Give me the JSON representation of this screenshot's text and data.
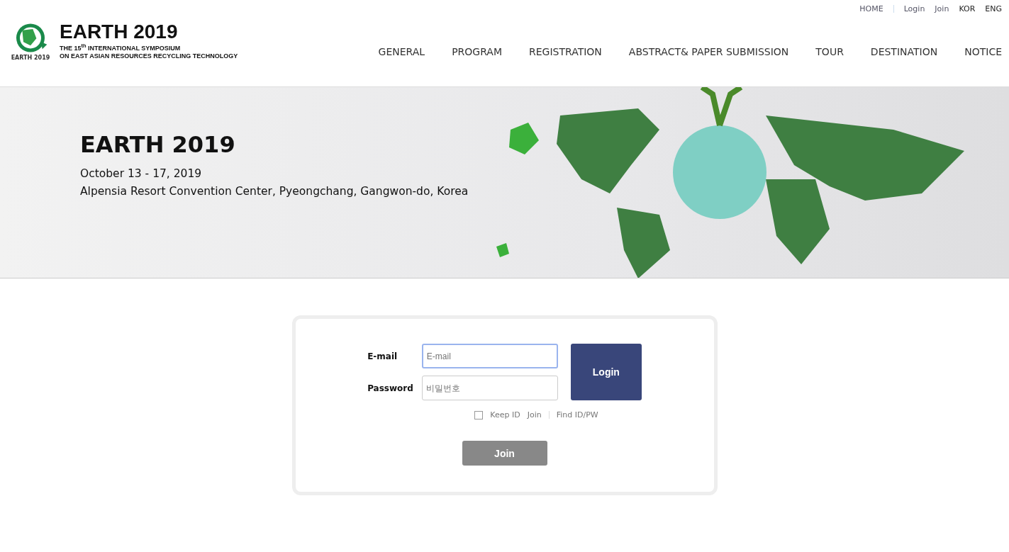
{
  "top_links": [
    {
      "label": "HOME",
      "kind": "link"
    },
    {
      "label": "Login",
      "kind": "link"
    },
    {
      "label": "Join",
      "kind": "link"
    },
    {
      "label": "KOR",
      "kind": "lang"
    },
    {
      "label": "ENG",
      "kind": "lang"
    }
  ],
  "logo": {
    "badge_text": "EARTH 2019",
    "title": "EARTH 2019",
    "subtitle_1": "THE 15$^{th}$ INTERNATIONAL SYMPOSIUM",
    "subtitle_2": "ON EAST ASIAN RESOURCES RECYCLING TECHNOLOGY"
  },
  "nav": [
    "GENERAL",
    "PROGRAM",
    "REGISTRATION",
    "ABSTRACT& PAPER SUBMISSION",
    "TOUR",
    "DESTINATION",
    "NOTICE"
  ],
  "banner": {
    "title": "EARTH 2019",
    "date": "October 13 - 17, 2019",
    "venue": "Alpensia Resort Convention Center, Pyeongchang, Gangwon-do, Korea"
  },
  "login_form": {
    "email_label": "E-mail",
    "email_placeholder": "E-mail",
    "password_label": "Password",
    "password_placeholder": "비밀번호",
    "login_button": "Login",
    "keep_id": {
      "label": "Keep ID",
      "checked": false
    },
    "join_link": "Join",
    "find_link": "Find ID/PW",
    "join_button": "Join"
  }
}
